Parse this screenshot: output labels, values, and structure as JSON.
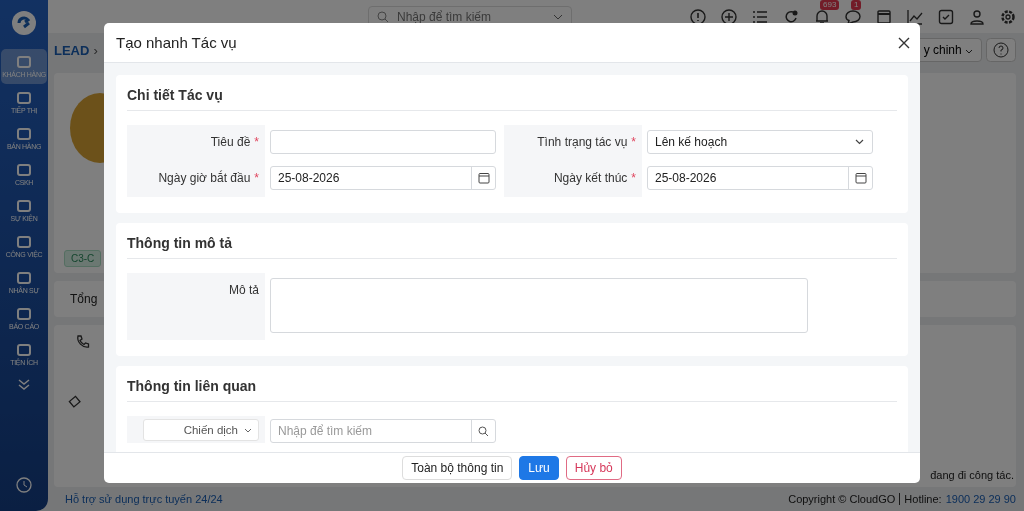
{
  "sidebar": {
    "items": [
      {
        "label": "KHÁCH HÀNG",
        "selected": true
      },
      {
        "label": "TIẾP THỊ",
        "selected": false
      },
      {
        "label": "BÁN HÀNG",
        "selected": false
      },
      {
        "label": "CSKH",
        "selected": false
      },
      {
        "label": "SỰ KIỆN",
        "selected": false
      },
      {
        "label": "CÔNG VIỆC",
        "selected": false
      },
      {
        "label": "NHÂN SỰ",
        "selected": false
      },
      {
        "label": "BÁO CÁO",
        "selected": false
      },
      {
        "label": "TIỆN ÍCH",
        "selected": false
      }
    ]
  },
  "topbar": {
    "search": {
      "placeholder": "Nhập để tìm kiếm"
    },
    "notifications_badge": "693",
    "messages_badge": "1"
  },
  "page": {
    "breadcrumb": "LEAD",
    "breadcrumb_separator": "›",
    "customize_button": "y chinh",
    "tag": "C3-C",
    "tab": "Tổng",
    "note": "đang đi công tác."
  },
  "modal": {
    "title": "Tạo nhanh Tác vụ",
    "sections": [
      {
        "title": "Chi tiết Tác vụ",
        "kind": "grid",
        "columns": [
          [
            {
              "label": "Tiêu đề",
              "required_mark": "*",
              "kind": "text"
            },
            {
              "label": "Ngày giờ bắt đầu",
              "required_mark": "*",
              "kind": "date",
              "value": "25-08-2026"
            }
          ],
          [
            {
              "label": "Tình trạng tác vụ",
              "required_mark": "*",
              "kind": "select",
              "value": "Lên kế hoạch"
            },
            {
              "label": "Ngày kết thúc",
              "required_mark": "*",
              "kind": "date",
              "value": "25-08-2026"
            }
          ]
        ]
      },
      {
        "title": "Thông tin mô tả",
        "kind": "grid",
        "columns": [
          [
            {
              "label": "Mô tả",
              "kind": "textarea"
            }
          ]
        ]
      },
      {
        "title": "Thông tin liên quan",
        "kind": "grid",
        "columns": [
          [
            {
              "label": "Chiến dịch",
              "kind": "lookup",
              "placeholder": "Nhập để tìm kiếm"
            }
          ]
        ]
      }
    ],
    "buttons": [
      {
        "label": "Toàn bộ thông tin",
        "kind": "default"
      },
      {
        "label": "Lưu",
        "kind": "primary"
      },
      {
        "label": "Hủy bỏ",
        "kind": "danger"
      }
    ]
  },
  "footer": {
    "support": "Hỗ trợ sử dụng trực tuyến 24/24",
    "copyright": "Copyright © CloudGO",
    "hotline_label": "Hotline:",
    "hotline": "1900 29 29 90"
  }
}
